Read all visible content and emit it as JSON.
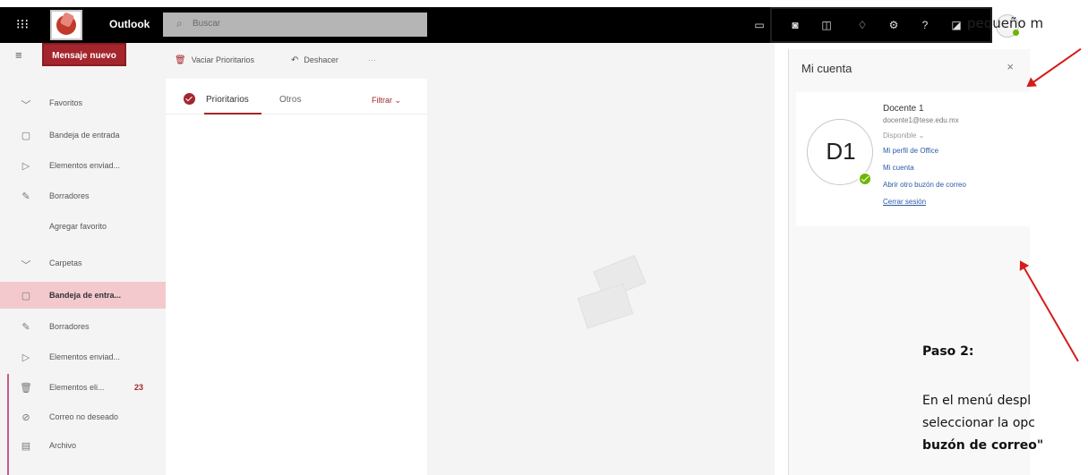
{
  "topbar": {
    "app_name": "Outlook",
    "search_placeholder": "Buscar",
    "waffle_glyph": "⁝⁝⁝",
    "note_fragment": "pequeño m"
  },
  "leftnav": {
    "new_message_label": "Mensaje nuevo",
    "favorites_label": "Favoritos",
    "favorites": [
      {
        "label": "Bandeja de entrada",
        "icon": "inbox-icon"
      },
      {
        "label": "Elementos enviad...",
        "icon": "send-icon"
      },
      {
        "label": "Borradores",
        "icon": "pencil-icon"
      }
    ],
    "add_favorite_label": "Agregar favorito",
    "folders_label": "Carpetas",
    "folders": [
      {
        "label": "Bandeja de entra...",
        "icon": "inbox-icon",
        "selected": true,
        "count": ""
      },
      {
        "label": "Borradores",
        "icon": "pencil-icon",
        "count": ""
      },
      {
        "label": "Elementos enviad...",
        "icon": "send-icon",
        "count": ""
      },
      {
        "label": "Elementos eli...",
        "icon": "trash-icon",
        "count": "23"
      },
      {
        "label": "Correo no deseado",
        "icon": "block-icon",
        "count": ""
      },
      {
        "label": "Archivo",
        "icon": "archive-icon",
        "count": ""
      }
    ]
  },
  "commandbar": {
    "empty_focused": "Vaciar Prioritarios",
    "undo": "Deshacer",
    "more": "···"
  },
  "messagelist": {
    "tab_focused": "Prioritarios",
    "tab_other": "Otros",
    "filter": "Filtrar"
  },
  "account_panel": {
    "title": "Mi cuenta",
    "close_glyph": "×",
    "initials": "D1",
    "name": "Docente 1",
    "email": "docente1@tese.edu.mx",
    "status": "Disponible",
    "link_office_profile": "Mi perfil de Office",
    "link_my_account": "Mi cuenta",
    "link_open_other_mailbox": "Abrir otro buzón de correo",
    "link_sign_out": "Cerrar sesión"
  },
  "annotation": {
    "step_title": "Paso 2:",
    "line1": "En el menú despl",
    "line2": "seleccionar la opc",
    "line3": "buzón de correo\""
  },
  "colors": {
    "accent": "#a4262c",
    "selected_folder_bg": "#f3c9ce",
    "presence_green": "#6bb700",
    "link_blue": "#2b5aa8",
    "arrow_red": "#d71b1b"
  }
}
